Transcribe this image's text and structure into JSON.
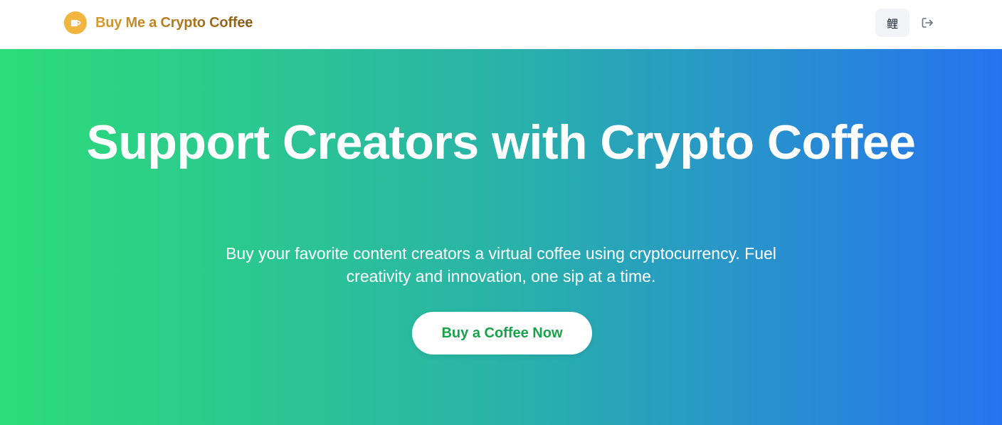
{
  "nav": {
    "brand_name": "Buy Me a Crypto Coffee",
    "brand_icon": "coffee-cup-icon",
    "user_button_label": "鲤",
    "logout_icon": "logout-icon"
  },
  "hero": {
    "title": "Support Creators with Crypto Coffee",
    "subtitle": "Buy your favorite content creators a virtual coffee using cryptocurrency. Fuel creativity and innovation, one sip at a time.",
    "cta_label": "Buy a Coffee Now"
  },
  "colors": {
    "brand_gold": "#f2b53f",
    "gradient_start": "#2ddc78",
    "gradient_end": "#2673ef",
    "cta_text": "#16a34a"
  }
}
